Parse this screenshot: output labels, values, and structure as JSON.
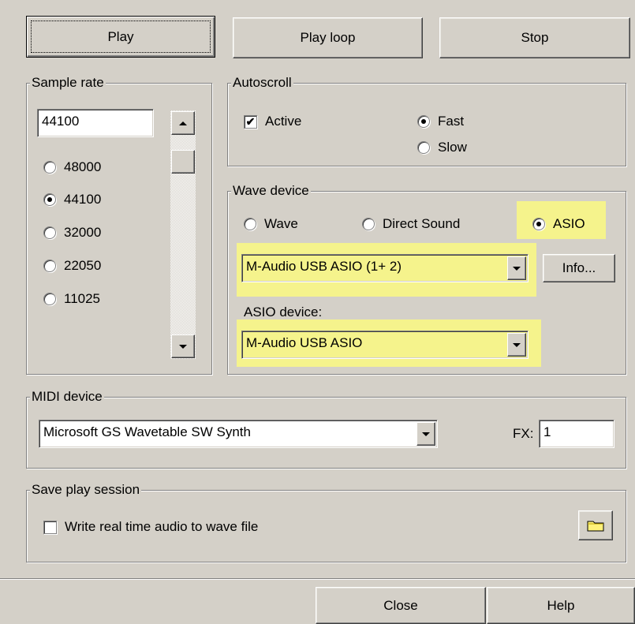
{
  "toolbar": {
    "play_label": "Play",
    "play_loop_label": "Play loop",
    "stop_label": "Stop"
  },
  "sample_rate": {
    "title": "Sample rate",
    "value": "44100",
    "options": [
      "48000",
      "44100",
      "32000",
      "22050",
      "11025"
    ],
    "selected": "44100"
  },
  "autoscroll": {
    "title": "Autoscroll",
    "active_label": "Active",
    "active_checked": true,
    "fast_label": "Fast",
    "slow_label": "Slow",
    "selected": "Fast"
  },
  "wave_device": {
    "title": "Wave device",
    "options": [
      "Wave",
      "Direct Sound",
      "ASIO"
    ],
    "selected": "ASIO",
    "device_value": "M-Audio USB ASIO (1+ 2)",
    "info_label": "Info...",
    "asio_device_label": "ASIO device:",
    "asio_device_value": "M-Audio USB ASIO",
    "highlight_color": "#f5f38c"
  },
  "midi_device": {
    "title": "MIDI device",
    "value": "Microsoft GS Wavetable SW Synth",
    "fx_label": "FX:",
    "fx_value": "1"
  },
  "save_session": {
    "title": "Save play session",
    "write_label": "Write real time audio to wave file",
    "write_checked": false,
    "folder_icon": "folder-icon"
  },
  "footer": {
    "close_label": "Close",
    "help_label": "Help"
  }
}
